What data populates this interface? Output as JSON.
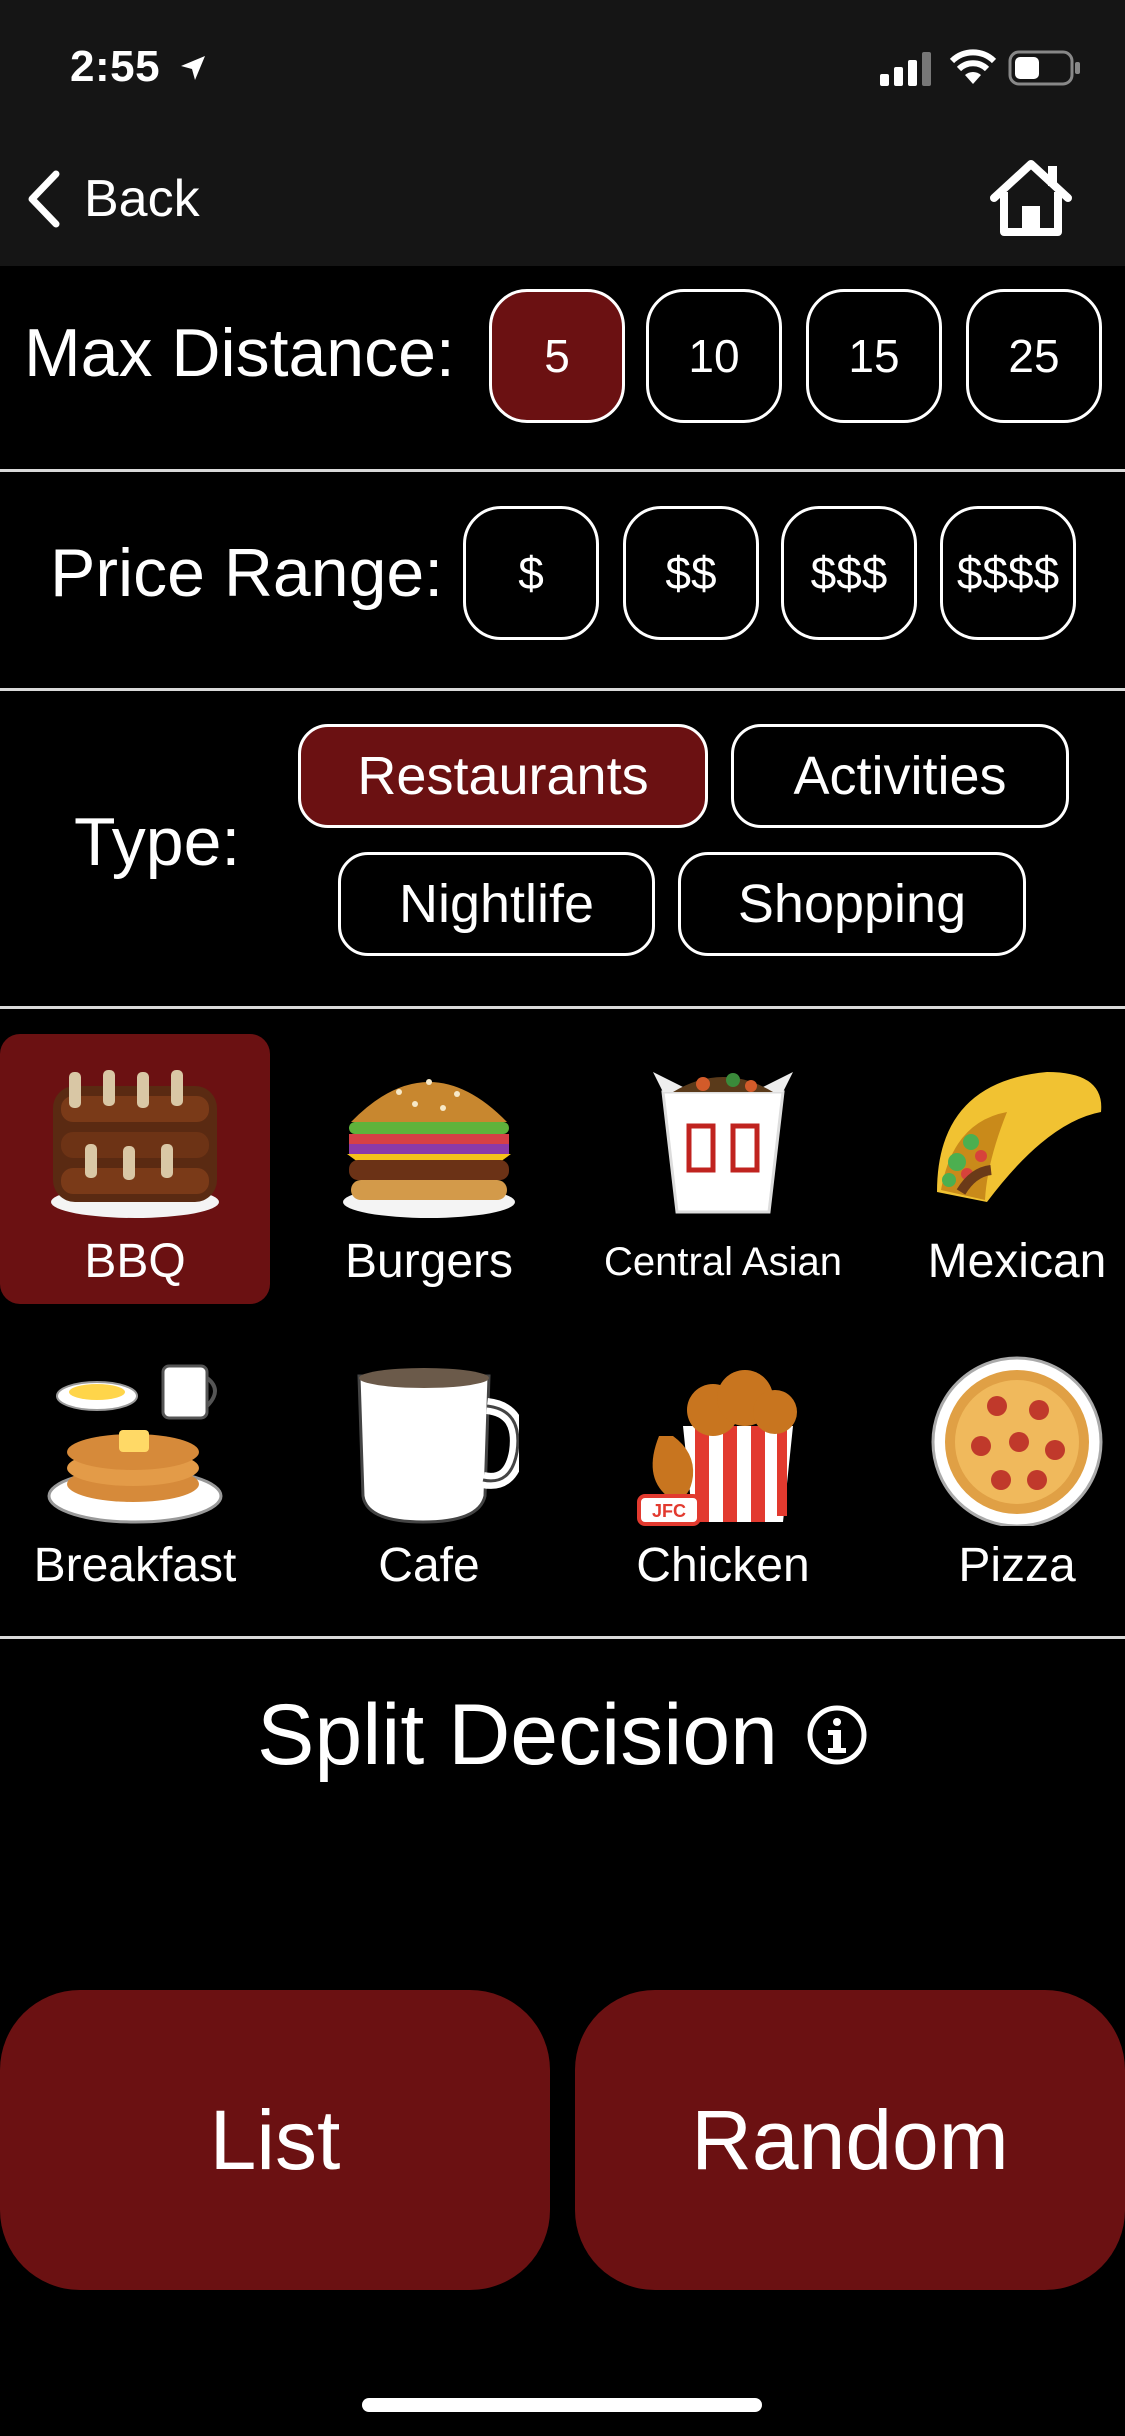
{
  "status": {
    "time": "2:55"
  },
  "nav": {
    "back_label": "Back"
  },
  "distance": {
    "label": "Max Distance:",
    "options": [
      "5",
      "10",
      "15",
      "25"
    ],
    "selected": "5"
  },
  "price": {
    "label": "Price Range:",
    "options": [
      "$",
      "$$",
      "$$$",
      "$$$$"
    ]
  },
  "type": {
    "label": "Type:",
    "options": [
      "Restaurants",
      "Activities",
      "Nightlife",
      "Shopping"
    ],
    "selected": "Restaurants"
  },
  "categories": [
    {
      "label": "BBQ",
      "icon": "bbq-ribs-icon",
      "selected": true
    },
    {
      "label": "Burgers",
      "icon": "burger-icon"
    },
    {
      "label": "Central Asian",
      "icon": "takeout-box-icon"
    },
    {
      "label": "Mexican",
      "icon": "taco-icon"
    },
    {
      "label": "Breakfast",
      "icon": "pancakes-icon"
    },
    {
      "label": "Cafe",
      "icon": "coffee-mug-icon"
    },
    {
      "label": "Chicken",
      "icon": "fried-chicken-icon"
    },
    {
      "label": "Pizza",
      "icon": "pizza-icon"
    }
  ],
  "takeout_box_text": "JFC",
  "split": {
    "title": "Split Decision"
  },
  "buttons": {
    "list": "List",
    "random": "Random"
  },
  "colors": {
    "accent": "#6b1112",
    "background": "#000000",
    "bar": "#151515"
  }
}
